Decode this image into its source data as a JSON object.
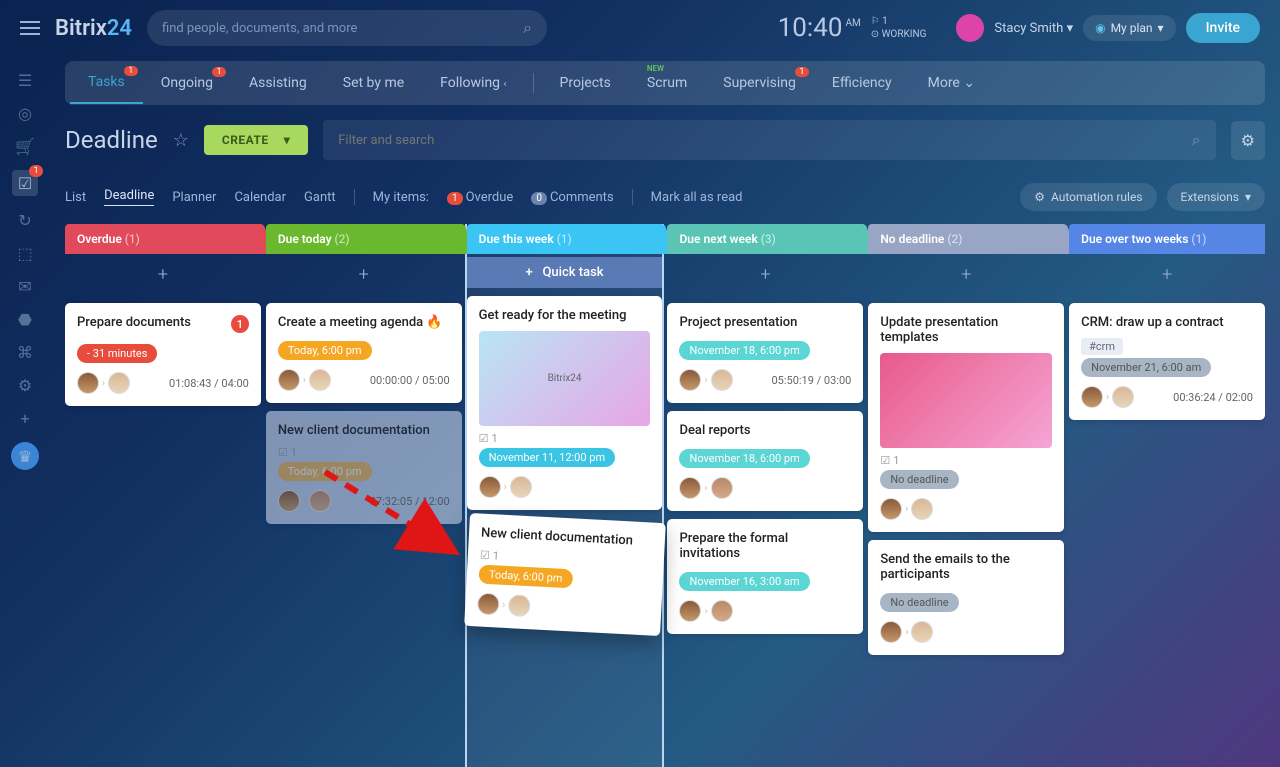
{
  "header": {
    "logo": "Bitrix",
    "logo24": "24",
    "search_placeholder": "find people, documents, and more",
    "time": "10:40",
    "am": "AM",
    "work_count": "1",
    "working": "WORKING",
    "user": "Stacy Smith",
    "my_plan": "My plan",
    "invite": "Invite"
  },
  "tabs": [
    "Tasks",
    "Ongoing",
    "Assisting",
    "Set by me",
    "Following",
    "Projects",
    "Scrum",
    "Supervising",
    "Efficiency",
    "More"
  ],
  "page": {
    "title": "Deadline",
    "create": "CREATE",
    "filter_placeholder": "Filter and search"
  },
  "viewbar": {
    "views": [
      "List",
      "Deadline",
      "Planner",
      "Calendar",
      "Gantt"
    ],
    "my_items": "My items:",
    "overdue_count": "1",
    "overdue": "Overdue",
    "comments_count": "0",
    "comments": "Comments",
    "mark_all": "Mark all as read",
    "automation": "Automation rules",
    "extensions": "Extensions"
  },
  "columns": {
    "overdue": {
      "label": "Overdue",
      "count": "(1)"
    },
    "today": {
      "label": "Due today",
      "count": "(2)"
    },
    "week": {
      "label": "Due this week",
      "count": "(1)",
      "quick": "Quick task"
    },
    "next": {
      "label": "Due next week",
      "count": "(3)"
    },
    "nodl": {
      "label": "No deadline",
      "count": "(2)"
    },
    "over2": {
      "label": "Due over two weeks",
      "count": "(1)"
    }
  },
  "cards": {
    "c1": {
      "title": "Prepare documents",
      "badge": "1",
      "pill": "- 31 minutes",
      "timer": "01:08:43 / 04:00"
    },
    "c2": {
      "title": "Create a meeting agenda",
      "pill": "Today, 6:00 pm",
      "timer": "00:00:00 / 05:00"
    },
    "c3": {
      "title": "New client documentation",
      "chk": "1",
      "pill": "Today, 6:00 pm",
      "timer": "07:32:05 / 12:00"
    },
    "c4": {
      "title": "Get ready for the meeting",
      "chk": "1",
      "pill": "November 11, 12:00 pm"
    },
    "c5": {
      "title": "New client documentation",
      "chk": "1",
      "pill": "Today, 6:00 pm"
    },
    "c6": {
      "title": "Project presentation",
      "pill": "November 18, 6:00 pm",
      "timer": "05:50:19 / 03:00"
    },
    "c7": {
      "title": "Deal reports",
      "pill": "November 18, 6:00 pm"
    },
    "c8": {
      "title": "Prepare the formal invitations",
      "pill": "November 16, 3:00 am"
    },
    "c9": {
      "title": "Update presentation templates",
      "chk": "1",
      "pill": "No deadline"
    },
    "c10": {
      "title": "Send the emails to the participants",
      "pill": "No deadline"
    },
    "c11": {
      "title": "CRM: draw up a contract",
      "tag": "#crm",
      "pill": "November 21, 6:00 am",
      "timer": "00:36:24 / 02:00"
    }
  }
}
